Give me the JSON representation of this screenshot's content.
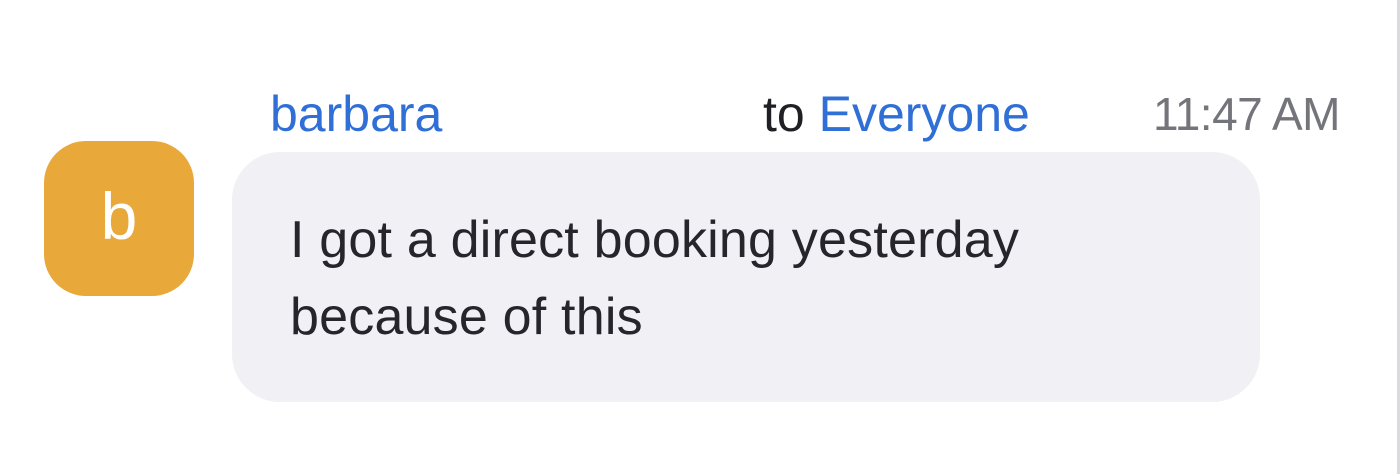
{
  "message": {
    "sender_initial": "b",
    "sender_name": "barbara",
    "recipient_prefix": "to",
    "recipient": "Everyone",
    "timestamp": "11:47 AM",
    "text": "I got a direct booking yesterday\nbecause of this",
    "colors": {
      "avatar_background": "#e8a93a",
      "name_link": "#2f6fd6",
      "bubble_background": "#f0f0f5",
      "timestamp": "#74747b"
    }
  }
}
